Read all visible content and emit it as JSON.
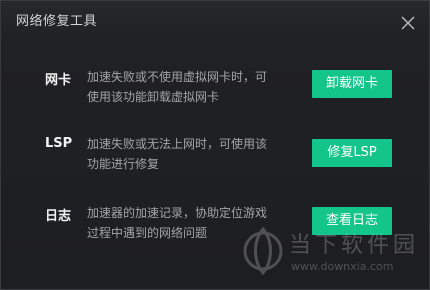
{
  "window": {
    "title": "网络修复工具"
  },
  "items": [
    {
      "label": "网卡",
      "desc_line1": "加速失败或不使用虚拟网卡时，可",
      "desc_line2": "使用该功能卸载虚拟网卡",
      "button": "卸载网卡"
    },
    {
      "label": "LSP",
      "desc_line1": "加速失败或无法上网时，可使用该",
      "desc_line2": "功能进行修复",
      "button": "修复LSP"
    },
    {
      "label": "日志",
      "desc_line1": "加速器的加速记录，协助定位游戏",
      "desc_line2": "过程中遇到的网络问题",
      "button": "查看日志"
    }
  ],
  "watermark": {
    "brand": "当下软件园",
    "url": "www.downxia.com"
  },
  "colors": {
    "accent": "#14c58a",
    "background": "#1d1e22",
    "text_secondary": "#a3a4a8"
  }
}
